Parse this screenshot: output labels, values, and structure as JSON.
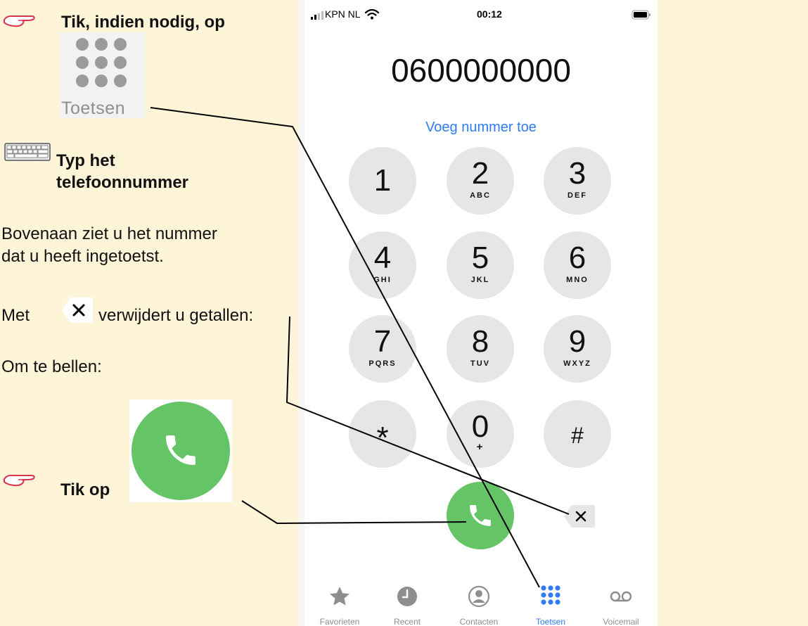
{
  "instructions": {
    "step1": "Tik, indien nodig, op",
    "keypad_label": "Toetsen",
    "step2_line1": "Typ het",
    "step2_line2": "telefoonnummer",
    "info_line1": "Bovenaan ziet u het nummer",
    "info_line2": "dat u heeft ingetoetst.",
    "delete_prefix": "Met",
    "delete_suffix": "verwijdert u getallen:",
    "call_text": "Om te bellen:",
    "tap_text": "Tik op"
  },
  "status_bar": {
    "carrier": "KPN NL",
    "time": "00:12"
  },
  "dialer": {
    "number": "0600000000",
    "add_number": "Voeg nummer toe",
    "keys": [
      {
        "digit": "1",
        "letters": ""
      },
      {
        "digit": "2",
        "letters": "ABC"
      },
      {
        "digit": "3",
        "letters": "DEF"
      },
      {
        "digit": "4",
        "letters": "GHI"
      },
      {
        "digit": "5",
        "letters": "JKL"
      },
      {
        "digit": "6",
        "letters": "MNO"
      },
      {
        "digit": "7",
        "letters": "PQRS"
      },
      {
        "digit": "8",
        "letters": "TUV"
      },
      {
        "digit": "9",
        "letters": "WXYZ"
      },
      {
        "digit": "*",
        "letters": ""
      },
      {
        "digit": "0",
        "letters": "+"
      },
      {
        "digit": "#",
        "letters": ""
      }
    ]
  },
  "tabs": [
    {
      "label": "Favorieten",
      "icon": "star-icon"
    },
    {
      "label": "Recent",
      "icon": "clock-icon"
    },
    {
      "label": "Contacten",
      "icon": "contact-icon"
    },
    {
      "label": "Toetsen",
      "icon": "keypad-icon",
      "active": true
    },
    {
      "label": "Voicemail",
      "icon": "voicemail-icon"
    }
  ],
  "colors": {
    "panel_bg": "#fef4d8",
    "call_green": "#65c466",
    "link_blue": "#2f7cf6",
    "key_grey": "#e6e6e6"
  }
}
